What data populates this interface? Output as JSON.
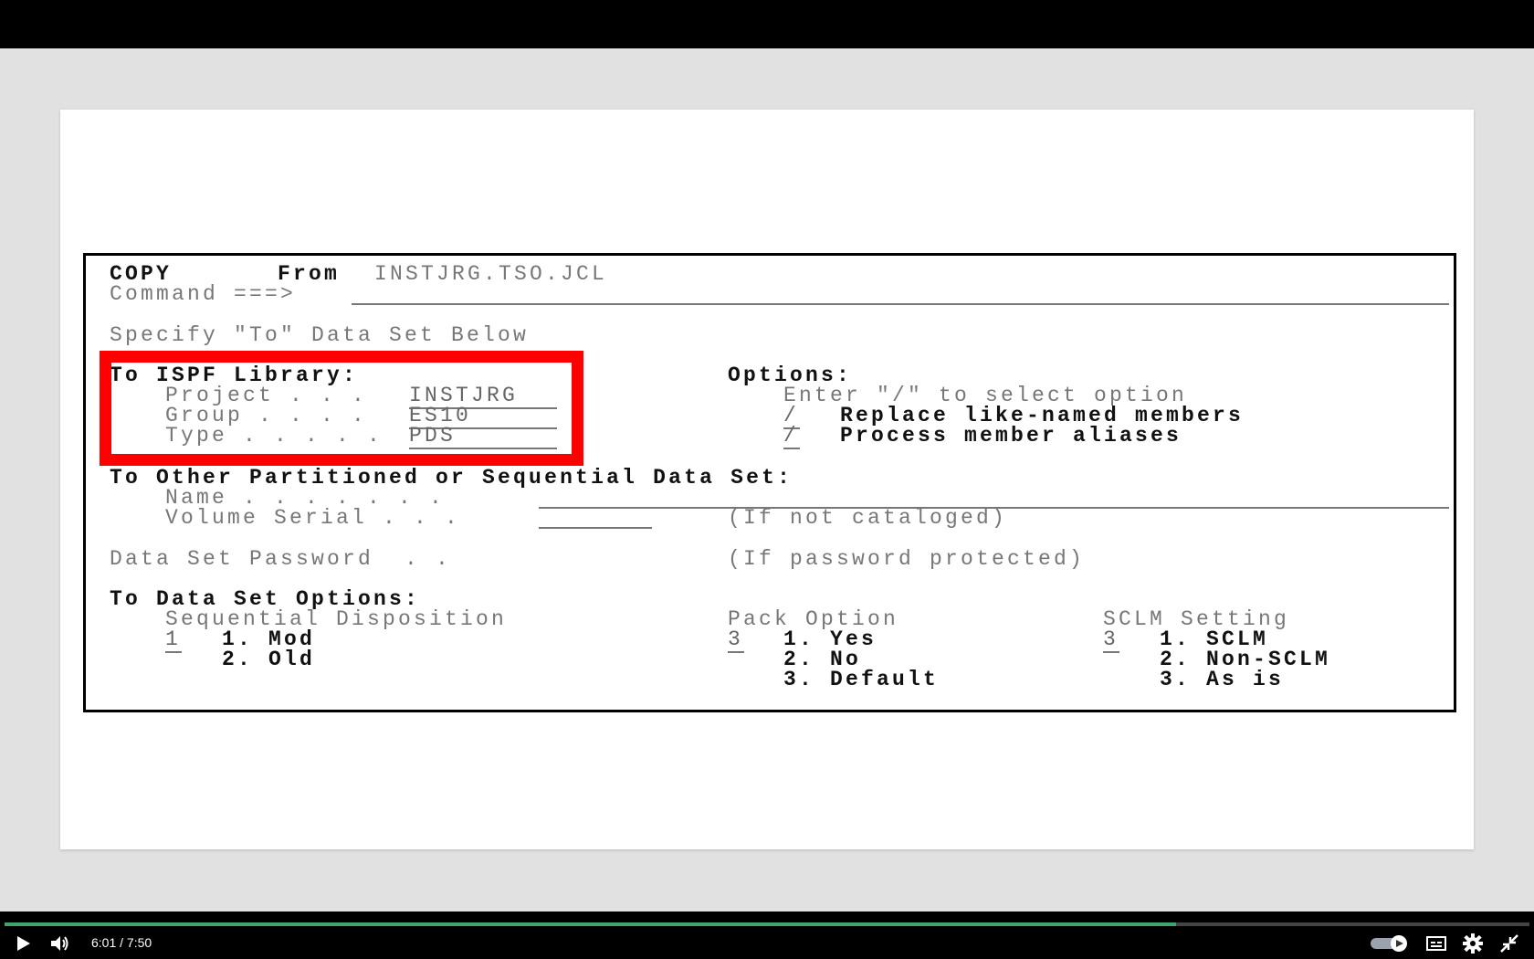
{
  "screen": {
    "row1": {
      "copy": "COPY",
      "from": "From",
      "dataset": "INSTJRG.TSO.JCL"
    },
    "command_label": "Command ===>",
    "specify": "Specify \"To\" Data Set Below",
    "to_ispf": "To ISPF Library:",
    "project_label": "Project . . .",
    "project_value": "INSTJRG",
    "group_label": "Group . . . .",
    "group_value": "ES10",
    "type_label": "Type . . . . .",
    "type_value": "PDS",
    "options_title": "Options:",
    "options_hint": "Enter \"/\" to select option",
    "opt1_mark": "/",
    "opt1_label": "Replace like-named members",
    "opt2_mark": "/",
    "opt2_label": "Process member aliases",
    "other_title": "To Other Partitioned or Sequential Data Set:",
    "name_label": "Name . . . . . . .",
    "volume_label": "Volume Serial . . .",
    "if_not_cataloged": "(If not cataloged)",
    "password_label": "Data Set Password  . .",
    "if_password": "(If password protected)",
    "ds_options": "To Data Set Options:",
    "seq_disp": "Sequential Disposition",
    "seq_value": "1",
    "seq_opt1": "1. Mod",
    "seq_opt2": "2. Old",
    "pack_title": "Pack Option",
    "pack_value": "3",
    "pack_opt1": "1. Yes",
    "pack_opt2": "2. No",
    "pack_opt3": "3. Default",
    "sclm_title": "SCLM Setting",
    "sclm_value": "3",
    "sclm_opt1": "1. SCLM",
    "sclm_opt2": "2. Non-SCLM",
    "sclm_opt3": "3. As is"
  },
  "player": {
    "current_time": "6:01",
    "separator": "/",
    "duration": "7:50",
    "progress_fraction": 0.768,
    "accent": "#3ea56b",
    "icons": [
      "play-icon",
      "volume-icon",
      "autoplay-toggle",
      "captions-icon",
      "settings-icon",
      "exit-fullscreen-icon"
    ]
  },
  "colors": {
    "highlight": "#ff0000"
  }
}
